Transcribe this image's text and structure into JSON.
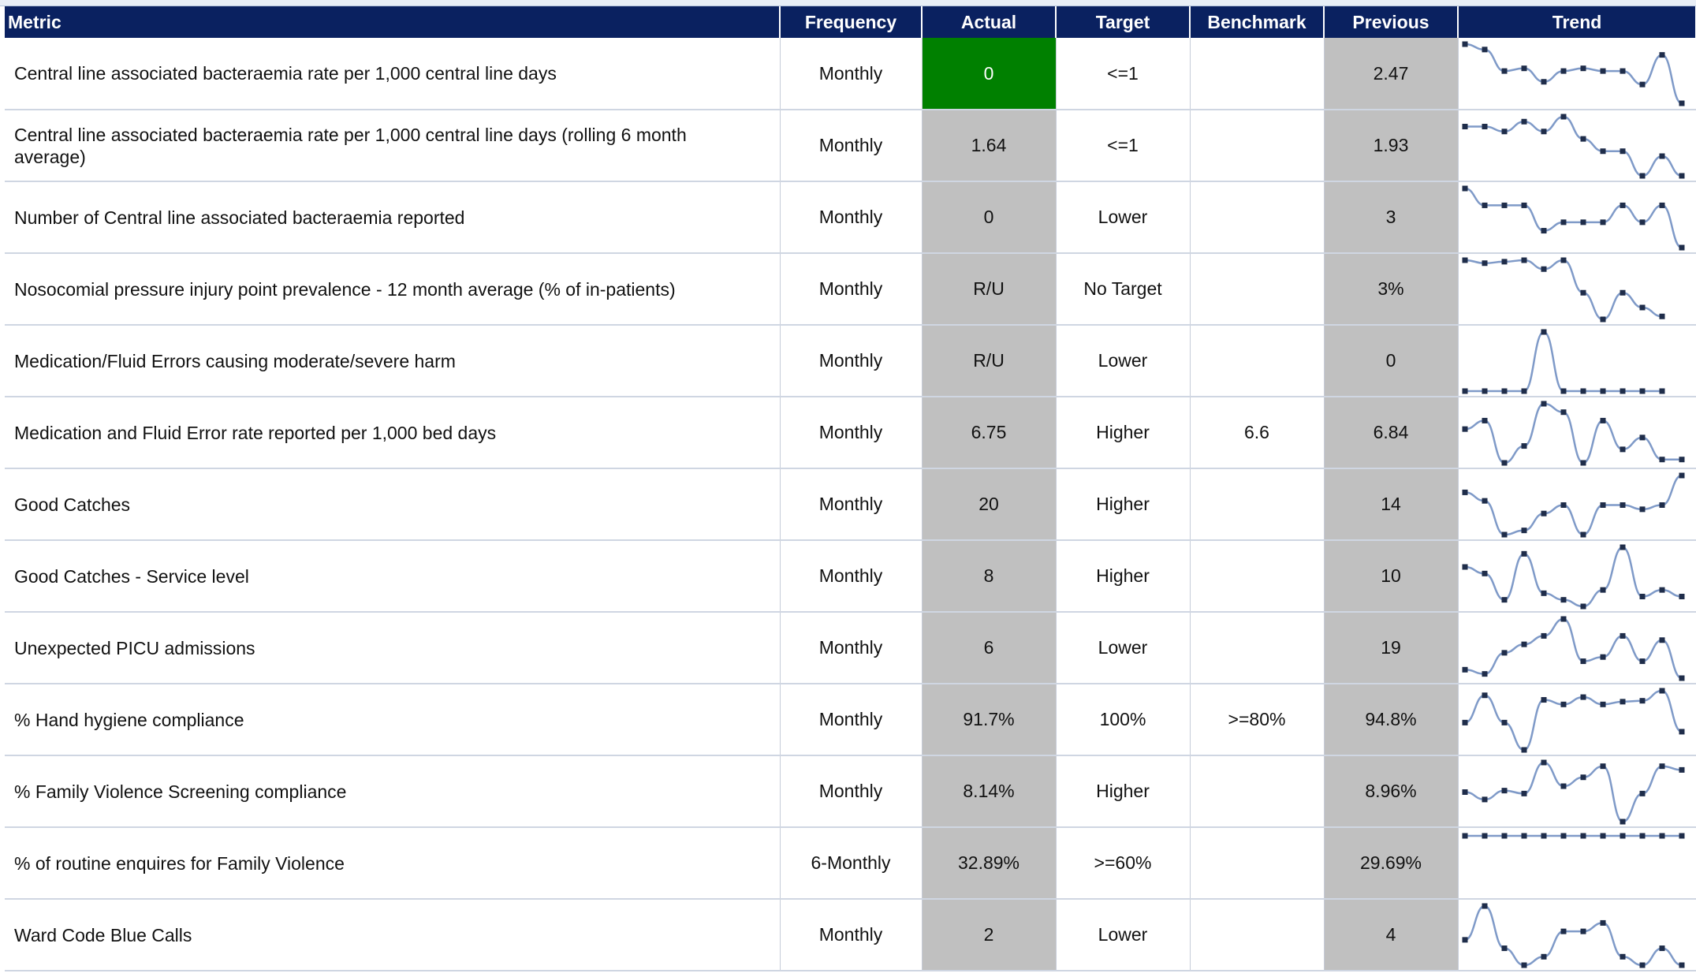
{
  "header": {
    "metric": "Metric",
    "frequency": "Frequency",
    "actual": "Actual",
    "target": "Target",
    "benchmark": "Benchmark",
    "previous": "Previous",
    "trend": "Trend"
  },
  "colors": {
    "header_bg": "#0a2160",
    "actual_good": "#008000",
    "grey_cell": "#c0c0c0",
    "spark_line": "#7f9ac8",
    "spark_marker": "#1f2d4a"
  },
  "rows": [
    {
      "metric": "Central line associated bacteraemia rate per 1,000 central line days",
      "frequency": "Monthly",
      "actual": "0",
      "actual_status": "good",
      "target": "<=1",
      "benchmark": "",
      "previous": "2.47",
      "trend": [
        8,
        7,
        3,
        3.5,
        1,
        3,
        3.5,
        3,
        3,
        0.5,
        6,
        -3
      ]
    },
    {
      "metric": "Central line associated bacteraemia rate per 1,000 central line days (rolling 6 month average)",
      "frequency": "Monthly",
      "actual": "1.64",
      "actual_status": "neutral",
      "target": "<=1",
      "benchmark": "",
      "previous": "1.93",
      "trend": [
        4,
        4,
        3.8,
        4.2,
        3.8,
        4.4,
        3.5,
        3,
        3,
        2,
        2.8,
        2
      ]
    },
    {
      "metric": "Number of Central line associated bacteraemia reported",
      "frequency": "Monthly",
      "actual": "0",
      "actual_status": "neutral",
      "target": "Lower",
      "benchmark": "",
      "previous": "3",
      "trend": [
        6,
        4,
        4,
        4,
        1,
        2,
        2,
        2,
        4,
        2,
        4,
        -1
      ]
    },
    {
      "metric": "Nosocomial pressure injury point prevalence - 12 month average (% of in-patients)",
      "frequency": "Monthly",
      "actual": "R/U",
      "actual_status": "neutral",
      "target": "No Target",
      "benchmark": "",
      "previous": "3%",
      "trend": [
        6,
        5.8,
        5.9,
        6,
        5.4,
        6,
        3.8,
        2,
        3.8,
        2.8,
        2.2
      ]
    },
    {
      "metric": "Medication/Fluid Errors causing moderate/severe harm",
      "frequency": "Monthly",
      "actual": "R/U",
      "actual_status": "neutral",
      "target": "Lower",
      "benchmark": "",
      "previous": "0",
      "trend": [
        0,
        0,
        0,
        0,
        1,
        0,
        0,
        0,
        0,
        0,
        0
      ]
    },
    {
      "metric": "Medication and Fluid Error rate reported per 1,000 bed days",
      "frequency": "Monthly",
      "actual": "6.75",
      "actual_status": "neutral",
      "target": "Higher",
      "benchmark": "6.6",
      "previous": "6.84",
      "trend": [
        5,
        5.5,
        3,
        4,
        6.5,
        6,
        3,
        5.5,
        3.8,
        4.5,
        3.2,
        3.2
      ]
    },
    {
      "metric": "Good Catches",
      "frequency": "Monthly",
      "actual": "20",
      "actual_status": "neutral",
      "target": "Higher",
      "benchmark": "",
      "previous": "14",
      "trend": [
        15,
        13,
        5,
        6,
        10,
        12,
        5,
        12,
        12,
        11,
        12,
        19
      ]
    },
    {
      "metric": "Good Catches - Service level",
      "frequency": "Monthly",
      "actual": "8",
      "actual_status": "neutral",
      "target": "Higher",
      "benchmark": "",
      "previous": "10",
      "trend": [
        13,
        11,
        3,
        17,
        5,
        3,
        1,
        6,
        19,
        4,
        6,
        4
      ]
    },
    {
      "metric": "Unexpected PICU admissions",
      "frequency": "Monthly",
      "actual": "6",
      "actual_status": "neutral",
      "target": "Lower",
      "benchmark": "",
      "previous": "19",
      "trend": [
        8,
        7,
        12,
        14,
        16,
        20,
        10,
        11,
        16,
        10,
        15,
        6
      ]
    },
    {
      "metric": "% Hand hygiene compliance",
      "frequency": "Monthly",
      "actual": "91.7%",
      "actual_status": "neutral",
      "target": "100%",
      "benchmark": ">=80%",
      "previous": "94.8%",
      "trend": [
        94,
        97,
        94,
        91,
        96.5,
        96,
        96.8,
        96,
        96.3,
        96.4,
        97.5,
        93
      ]
    },
    {
      "metric": "% Family Violence Screening compliance",
      "frequency": "Monthly",
      "actual": "8.14%",
      "actual_status": "neutral",
      "target": "Higher",
      "benchmark": "",
      "previous": "8.96%",
      "trend": [
        8,
        7,
        8.2,
        7.8,
        12,
        8.8,
        10,
        11.5,
        4,
        7.8,
        11.5,
        11
      ]
    },
    {
      "metric": "% of routine enquires for Family Violence",
      "frequency": "6-Monthly",
      "actual": "32.89%",
      "actual_status": "neutral",
      "target": ">=60%",
      "benchmark": "",
      "previous": "29.69%",
      "trend": [
        30,
        30,
        30,
        30,
        30,
        30,
        30,
        30,
        30,
        30,
        30,
        30
      ]
    },
    {
      "metric": "Ward Code Blue Calls",
      "frequency": "Monthly",
      "actual": "2",
      "actual_status": "neutral",
      "target": "Lower",
      "benchmark": "",
      "previous": "4",
      "trend": [
        3,
        7,
        2,
        0,
        1,
        4,
        4,
        5,
        1,
        0,
        2,
        0
      ]
    }
  ]
}
